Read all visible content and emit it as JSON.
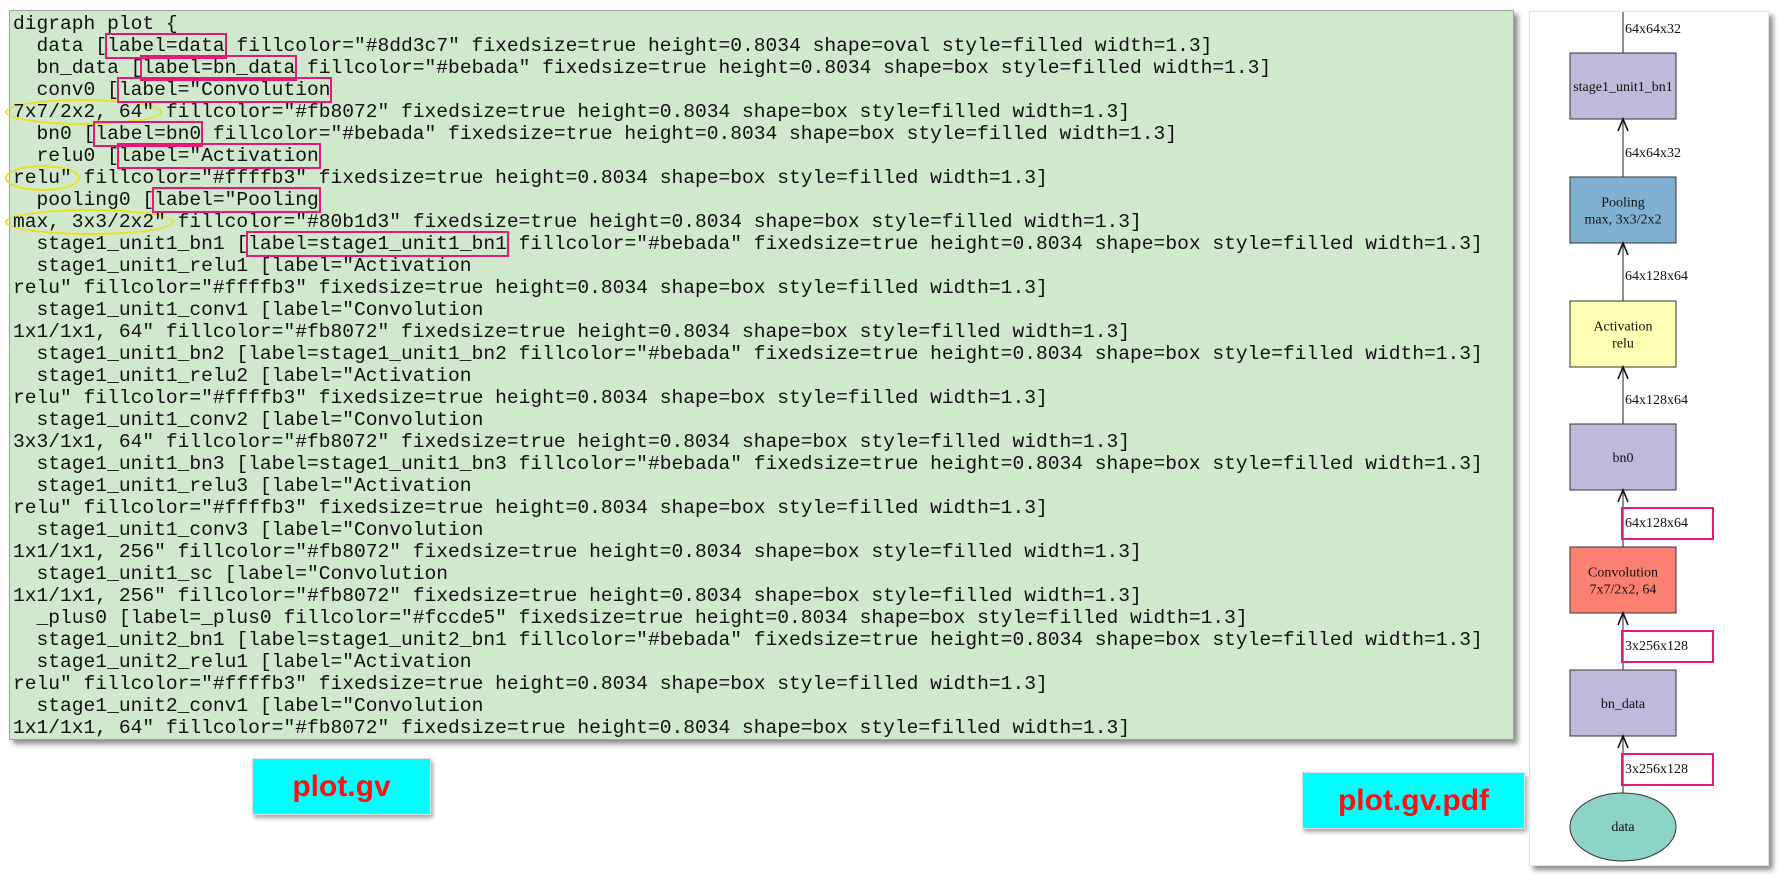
{
  "code": {
    "filename_label": "plot.gv",
    "lines": [
      [
        {
          "t": "digraph plot {"
        }
      ],
      [
        {
          "t": "  data ["
        },
        {
          "t": "label=data",
          "m": "box"
        },
        {
          "t": " fillcolor=\"#8dd3c7\" fixedsize=true height=0.8034 shape=oval style=filled width=1.3]"
        }
      ],
      [
        {
          "t": "  bn_data ["
        },
        {
          "t": "label=bn_data",
          "m": "box"
        },
        {
          "t": " fillcolor=\"#bebada\" fixedsize=true height=0.8034 shape=box style=filled width=1.3]"
        }
      ],
      [
        {
          "t": "  conv0 ["
        },
        {
          "t": "label=\"Convolution",
          "m": "box"
        }
      ],
      [
        {
          "t": "7x7/2x2, 64\"",
          "m": "ellipse"
        },
        {
          "t": " fillcolor=\"#fb8072\" fixedsize=true height=0.8034 shape=box style=filled width=1.3]"
        }
      ],
      [
        {
          "t": "  bn0 ["
        },
        {
          "t": "label=bn0",
          "m": "box"
        },
        {
          "t": " fillcolor=\"#bebada\" fixedsize=true height=0.8034 shape=box style=filled width=1.3]"
        }
      ],
      [
        {
          "t": "  relu0 ["
        },
        {
          "t": "label=\"Activation",
          "m": "box"
        }
      ],
      [
        {
          "t": "relu\"",
          "m": "ellipse"
        },
        {
          "t": " fillcolor=\"#ffffb3\" fixedsize=true height=0.8034 shape=box style=filled width=1.3]"
        }
      ],
      [
        {
          "t": "  pooling0 ["
        },
        {
          "t": "label=\"Pooling",
          "m": "box"
        }
      ],
      [
        {
          "t": "max, 3x3/2x2\"",
          "m": "ellipse"
        },
        {
          "t": " fillcolor=\"#80b1d3\" fixedsize=true height=0.8034 shape=box style=filled width=1.3]"
        }
      ],
      [
        {
          "t": "  stage1_unit1_bn1 ["
        },
        {
          "t": "label=stage1_unit1_bn1",
          "m": "box"
        },
        {
          "t": " fillcolor=\"#bebada\" fixedsize=true height=0.8034 shape=box style=filled width=1.3]"
        }
      ],
      [
        {
          "t": "  stage1_unit1_relu1 [label=\"Activation"
        }
      ],
      [
        {
          "t": "relu\" fillcolor=\"#ffffb3\" fixedsize=true height=0.8034 shape=box style=filled width=1.3]"
        }
      ],
      [
        {
          "t": "  stage1_unit1_conv1 [label=\"Convolution"
        }
      ],
      [
        {
          "t": "1x1/1x1, 64\" fillcolor=\"#fb8072\" fixedsize=true height=0.8034 shape=box style=filled width=1.3]"
        }
      ],
      [
        {
          "t": "  stage1_unit1_bn2 [label=stage1_unit1_bn2 fillcolor=\"#bebada\" fixedsize=true height=0.8034 shape=box style=filled width=1.3]"
        }
      ],
      [
        {
          "t": "  stage1_unit1_relu2 [label=\"Activation"
        }
      ],
      [
        {
          "t": "relu\" fillcolor=\"#ffffb3\" fixedsize=true height=0.8034 shape=box style=filled width=1.3]"
        }
      ],
      [
        {
          "t": "  stage1_unit1_conv2 [label=\"Convolution"
        }
      ],
      [
        {
          "t": "3x3/1x1, 64\" fillcolor=\"#fb8072\" fixedsize=true height=0.8034 shape=box style=filled width=1.3]"
        }
      ],
      [
        {
          "t": "  stage1_unit1_bn3 [label=stage1_unit1_bn3 fillcolor=\"#bebada\" fixedsize=true height=0.8034 shape=box style=filled width=1.3]"
        }
      ],
      [
        {
          "t": "  stage1_unit1_relu3 [label=\"Activation"
        }
      ],
      [
        {
          "t": "relu\" fillcolor=\"#ffffb3\" fixedsize=true height=0.8034 shape=box style=filled width=1.3]"
        }
      ],
      [
        {
          "t": "  stage1_unit1_conv3 [label=\"Convolution"
        }
      ],
      [
        {
          "t": "1x1/1x1, 256\" fillcolor=\"#fb8072\" fixedsize=true height=0.8034 shape=box style=filled width=1.3]"
        }
      ],
      [
        {
          "t": "  stage1_unit1_sc [label=\"Convolution"
        }
      ],
      [
        {
          "t": "1x1/1x1, 256\" fillcolor=\"#fb8072\" fixedsize=true height=0.8034 shape=box style=filled width=1.3]"
        }
      ],
      [
        {
          "t": "  _plus0 [label=_plus0 fillcolor=\"#fccde5\" fixedsize=true height=0.8034 shape=box style=filled width=1.3]"
        }
      ],
      [
        {
          "t": "  stage1_unit2_bn1 [label=stage1_unit2_bn1 fillcolor=\"#bebada\" fixedsize=true height=0.8034 shape=box style=filled width=1.3]"
        }
      ],
      [
        {
          "t": "  stage1_unit2_relu1 [label=\"Activation"
        }
      ],
      [
        {
          "t": "relu\" fillcolor=\"#ffffb3\" fixedsize=true height=0.8034 shape=box style=filled width=1.3]"
        }
      ],
      [
        {
          "t": "  stage1_unit2_conv1 [label=\"Convolution"
        }
      ],
      [
        {
          "t": "1x1/1x1, 64\" fillcolor=\"#fb8072\" fixedsize=true height=0.8034 shape=box style=filled width=1.3]"
        }
      ]
    ]
  },
  "graph": {
    "filename_label": "plot.gv.pdf",
    "nodes": [
      {
        "id": "stage1_unit1_bn1",
        "lines": [
          "stage1_unit1_bn1"
        ],
        "color": "#bebada",
        "shape": "box"
      },
      {
        "id": "pooling0",
        "lines": [
          "Pooling",
          "max, 3x3/2x2"
        ],
        "color": "#80b1d3",
        "shape": "box"
      },
      {
        "id": "relu0",
        "lines": [
          "Activation",
          "relu"
        ],
        "color": "#ffffb3",
        "shape": "box"
      },
      {
        "id": "bn0",
        "lines": [
          "bn0"
        ],
        "color": "#bebada",
        "shape": "box"
      },
      {
        "id": "conv0",
        "lines": [
          "Convolution",
          "7x7/2x2, 64"
        ],
        "color": "#fb8072",
        "shape": "box"
      },
      {
        "id": "bn_data",
        "lines": [
          "bn_data"
        ],
        "color": "#bebada",
        "shape": "box"
      },
      {
        "id": "data",
        "lines": [
          "data"
        ],
        "color": "#8dd3c7",
        "shape": "oval"
      }
    ],
    "edge_labels": [
      {
        "text": "64x64x32",
        "highlighted": false
      },
      {
        "text": "64x64x32",
        "highlighted": false
      },
      {
        "text": "64x128x64",
        "highlighted": false
      },
      {
        "text": "64x128x64",
        "highlighted": false
      },
      {
        "text": "64x128x64",
        "highlighted": true
      },
      {
        "text": "3x256x128",
        "highlighted": true
      },
      {
        "text": "3x256x128",
        "highlighted": true
      }
    ]
  },
  "colors": {
    "highlight_box": "#e8187a",
    "highlight_ellipse": "#e8e020",
    "code_bg": "#d0e9cc",
    "label_bg": "#00ffff",
    "label_text": "#ff1010"
  }
}
